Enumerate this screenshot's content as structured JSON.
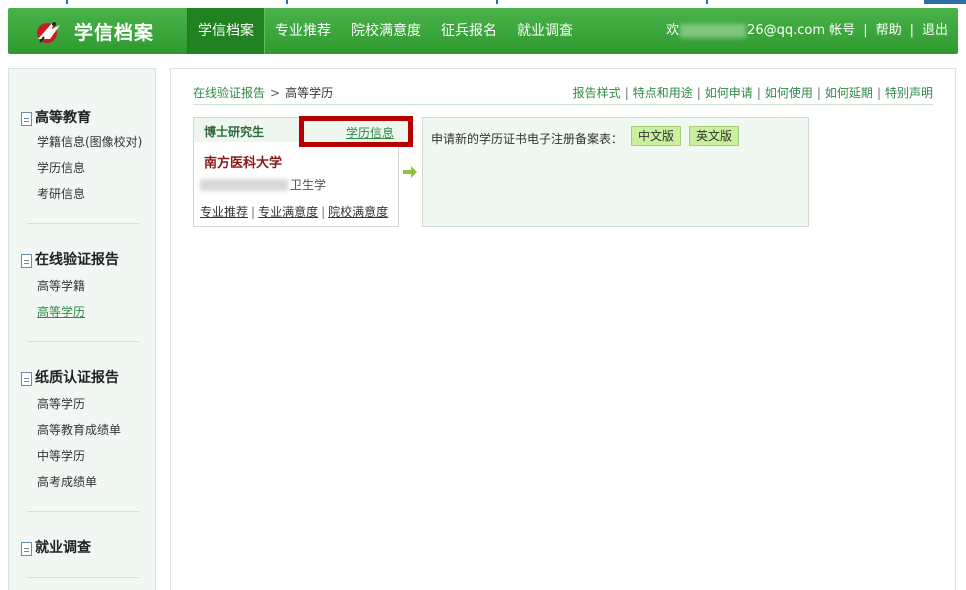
{
  "header": {
    "logo_text": "学信档案",
    "nav": [
      "学信档案",
      "专业推荐",
      "院校满意度",
      "征兵报名",
      "就业调查"
    ],
    "active_nav": "学信档案",
    "user": {
      "welcome_prefix": "欢",
      "email_suffix": "26@qq.com",
      "account": "帐号",
      "help": "帮助",
      "logout": "退出"
    }
  },
  "sidebar": {
    "sections": [
      {
        "title": "高等教育",
        "items": [
          "学籍信息(图像校对)",
          "学历信息",
          "考研信息"
        ]
      },
      {
        "title": "在线验证报告",
        "items": [
          "高等学籍",
          "高等学历"
        ]
      },
      {
        "title": "纸质认证报告",
        "items": [
          "高等学历",
          "高等教育成绩单",
          "中等学历",
          "高考成绩单"
        ]
      },
      {
        "title": "就业调查",
        "items": []
      }
    ],
    "active_item": "高等学历"
  },
  "breadcrumb": {
    "parent": "在线验证报告",
    "separator": ">",
    "current": "高等学历"
  },
  "top_links": [
    "报告样式",
    "特点和用途",
    "如何申请",
    "如何使用",
    "如何延期",
    "特别声明"
  ],
  "card": {
    "degree": "博士研究生",
    "info_link": "学历信息",
    "school": "南方医科大学",
    "major_suffix": "卫生学",
    "links": [
      "专业推荐",
      "专业满意度",
      "院校满意度"
    ]
  },
  "registration": {
    "label": "申请新的学历证书电子注册备案表：",
    "buttons": [
      "中文版",
      "英文版"
    ]
  },
  "colors": {
    "header_green": "#3aa63a",
    "link_green": "#2f8a46",
    "highlight_red": "#b40000",
    "button_green": "#c9ef9f",
    "school_red": "#8a1a1a"
  },
  "icons": [
    "logo-bird-icon",
    "document-icon",
    "right-arrow-icon"
  ]
}
